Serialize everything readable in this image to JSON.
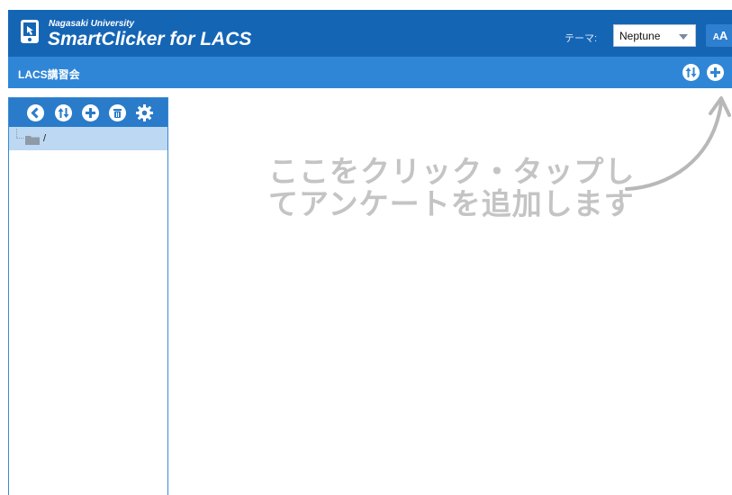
{
  "header": {
    "brand_small": "Nagasaki University",
    "brand_big": "SmartClicker for LACS",
    "theme_label": "テーマ:",
    "theme_value": "Neptune",
    "font_button_small": "A",
    "font_button_large": "A"
  },
  "subheader": {
    "title": "LACS講習会"
  },
  "sidebar": {
    "tree_root_label": "/"
  },
  "hint": {
    "line1": "ここをクリック・タップし",
    "line2": "てアンケートを追加します"
  },
  "colors": {
    "topbar": "#1565b5",
    "subbar": "#2f86d6",
    "selected_row": "#bcd8f3",
    "hint_text": "#c4c4c4"
  }
}
